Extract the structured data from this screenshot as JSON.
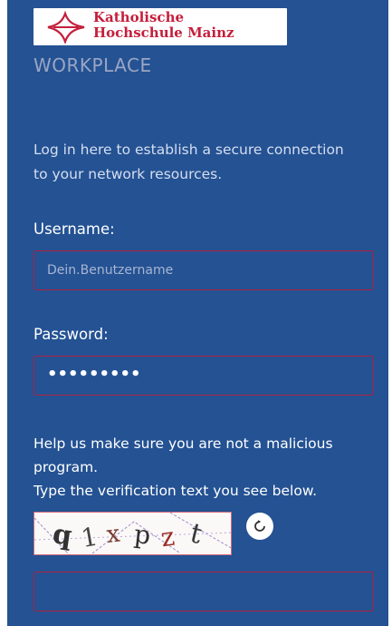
{
  "logo": {
    "line1": "Katholische",
    "line2": "Hochschule Mainz"
  },
  "app_title": "WORKPLACE",
  "intro_text": "Log in here to establish a secure connection to your network resources.",
  "username": {
    "label": "Username:",
    "placeholder": "Dein.Benutzername",
    "value": ""
  },
  "password": {
    "label": "Password:",
    "value": "•••••••••"
  },
  "verification": {
    "help_text": "Help us make sure you are not a malicious program.",
    "instruction": "Type the verification text you see below.",
    "captcha_text": "q1xpzt",
    "input_value": ""
  },
  "colors": {
    "background": "#245293",
    "field_border": "#b2213f",
    "brand_red": "#c41f3c"
  },
  "icons": {
    "logo_mark": "cross-logo-icon",
    "refresh": "refresh-icon"
  }
}
